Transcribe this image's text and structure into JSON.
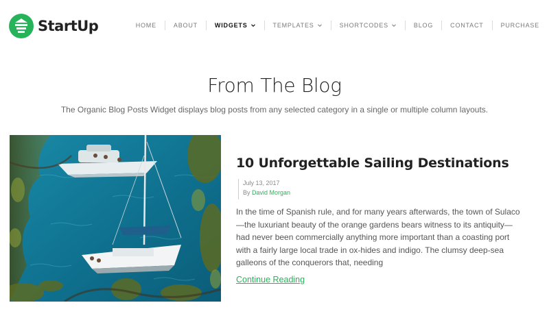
{
  "brand": {
    "name": "StartUp",
    "accent_color": "#27b35a"
  },
  "nav": {
    "items": [
      {
        "label": "HOME",
        "active": false,
        "dropdown": false
      },
      {
        "label": "ABOUT",
        "active": false,
        "dropdown": false
      },
      {
        "label": "WIDGETS",
        "active": true,
        "dropdown": true
      },
      {
        "label": "TEMPLATES",
        "active": false,
        "dropdown": true
      },
      {
        "label": "SHORTCODES",
        "active": false,
        "dropdown": true
      },
      {
        "label": "BLOG",
        "active": false,
        "dropdown": false
      },
      {
        "label": "CONTACT",
        "active": false,
        "dropdown": false
      },
      {
        "label": "PURCHASE",
        "active": false,
        "dropdown": false
      }
    ]
  },
  "section": {
    "title": "From The Blog",
    "description": "The Organic Blog Posts Widget displays blog posts from any selected category in a single or multiple column layouts."
  },
  "post": {
    "title": "10 Unforgettable Sailing Destinations",
    "date": "July 13, 2017",
    "by_label": "By",
    "author": "David Morgan",
    "excerpt": "In the time of Spanish rule, and for many years afterwards, the town of Sulaco—the luxuriant beauty of the orange gardens bears witness to its antiquity—had never been commercially anything more important than a coasting port with a fairly large local trade in ox-hides and indigo. The clumsy deep-sea galleons of the conquerors that, needing",
    "continue_label": "Continue Reading"
  }
}
